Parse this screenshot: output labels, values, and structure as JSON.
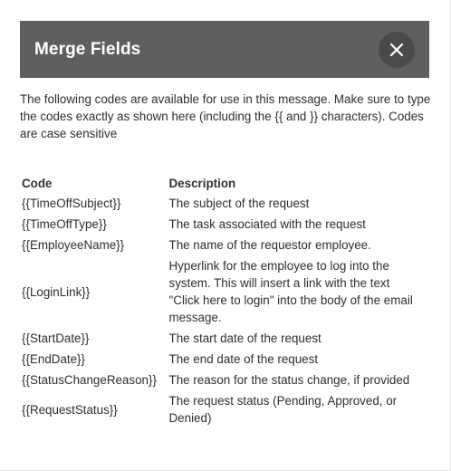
{
  "dialog": {
    "title": "Merge Fields",
    "close_icon": "close-icon"
  },
  "intro": "The following codes are available for use in this message. Make sure to type the codes exactly as shown here (including the {{ and }} characters). Codes are case sensitive",
  "table": {
    "headers": [
      "Code",
      "Description"
    ],
    "rows": [
      {
        "code": "{{TimeOffSubject}}",
        "description": "The subject of the request"
      },
      {
        "code": "{{TimeOffType}}",
        "description": "The task associated with the request"
      },
      {
        "code": "{{EmployeeName}}",
        "description": "The name of the requestor employee."
      },
      {
        "code": "{{LoginLink}}",
        "description": "Hyperlink for the employee to log into the system. This will insert a link with the text \"Click here to login\" into the body of the email message."
      },
      {
        "code": "{{StartDate}}",
        "description": "The start date of the request"
      },
      {
        "code": "{{EndDate}}",
        "description": "The end date of the request"
      },
      {
        "code": "{{StatusChangeReason}}",
        "description": "The reason for the status change, if provided"
      },
      {
        "code": "{{RequestStatus}}",
        "description": "The request status (Pending, Approved, or Denied)"
      }
    ]
  },
  "colors": {
    "header_bg": "#5f5f5f",
    "close_bg": "#4a4a4a",
    "text": "#2e2e2e"
  }
}
